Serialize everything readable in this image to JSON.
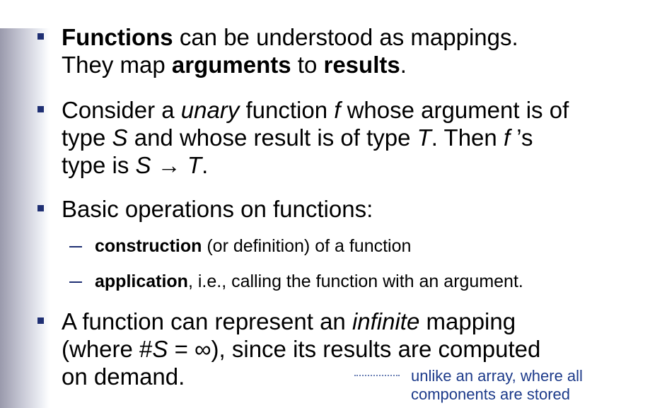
{
  "bullets": [
    {
      "line1_strong": "Functions",
      "line1_rest": " can be understood as mappings.",
      "line2_a": "They map ",
      "line2_strong1": "arguments",
      "line2_b": " to ",
      "line2_strong2": "results",
      "line2_c": "."
    },
    {
      "line1_a": "Consider a ",
      "line1_em": "unary",
      "line1_b": " function ",
      "line1_f": "f",
      "line1_c": " whose argument is of",
      "line2_a": "type ",
      "line2_S": "S",
      "line2_b": " and whose result is of type ",
      "line2_T": "T",
      "line2_c": ". Then ",
      "line2_f": "f",
      "line2_d": " ’s",
      "line3_a": "type is ",
      "line3_S": "S",
      "line3_arrow": " → ",
      "line3_T": "T",
      "line3_b": "."
    },
    {
      "text": "Basic operations on functions:",
      "subitems": [
        {
          "strong": "construction",
          "rest": " (or definition) of a function"
        },
        {
          "strong": "application",
          "rest": ", i.e., calling the function with an argument."
        }
      ]
    },
    {
      "line1_a": "A function can represent an ",
      "line1_em": "infinite",
      "line1_b": " mapping",
      "line2_a": "(where #",
      "line2_S": "S",
      "line2_b": " = ∞), since its results are computed",
      "line3": "on demand."
    }
  ],
  "note": {
    "line1": "unlike an array, where all",
    "line2": "components are stored"
  },
  "colors": {
    "bullet": "#1f2f73",
    "note": "#1c3a8a",
    "band": "#9a9aac"
  }
}
